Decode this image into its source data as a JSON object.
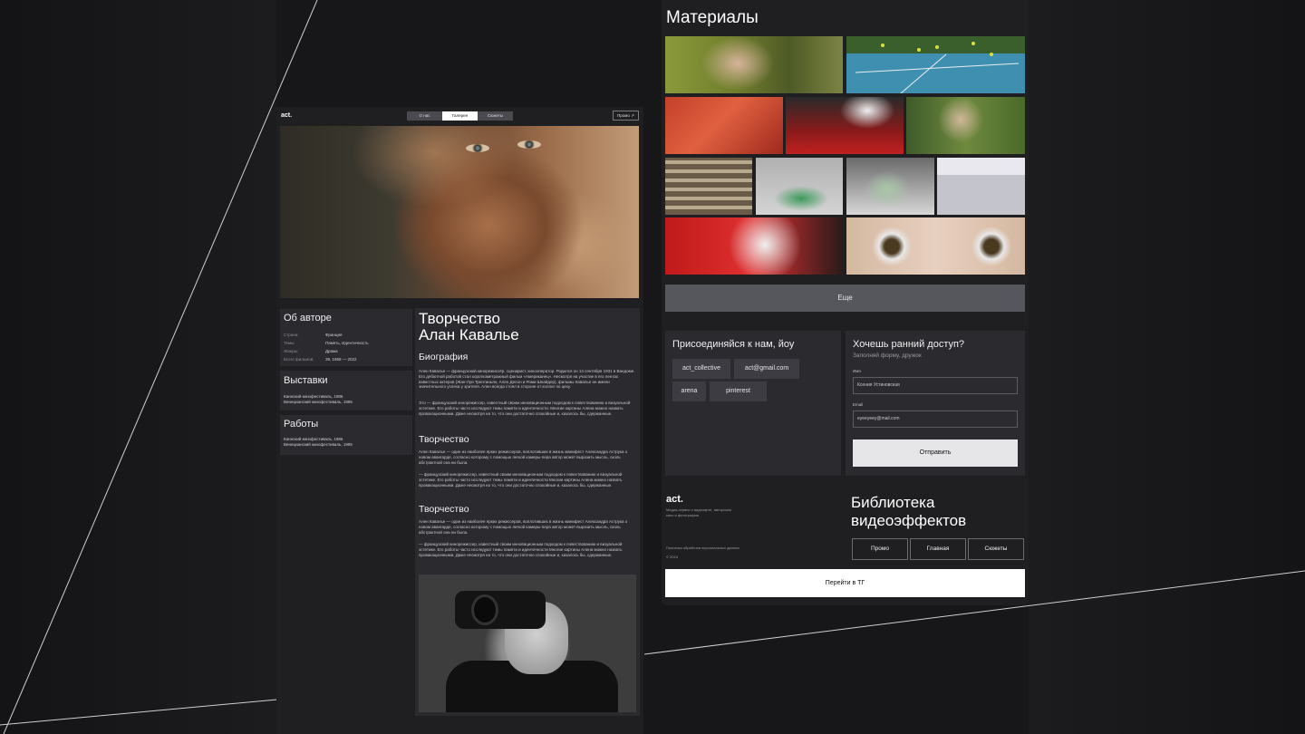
{
  "left": {
    "logo": "act.",
    "tabs": [
      "О нас",
      "Галерея",
      "Сюжеты"
    ],
    "active_tab": "Галерея",
    "promo": "Промо ↗",
    "about": {
      "title": "Об авторе",
      "rows": [
        {
          "label": "Страна:",
          "value": "Франция"
        },
        {
          "label": "Темы:",
          "value": "Память, Идентичность"
        },
        {
          "label": "Жанры:",
          "value": "Драма"
        },
        {
          "label": "Всего фильмов:",
          "value": "39, 1958 — 2022"
        }
      ]
    },
    "exhibitions": {
      "title": "Выставки",
      "lines": [
        "Каннский кинофестиваль, 1986",
        "Венецианский кинофестиваль, 1995"
      ]
    },
    "works": {
      "title": "Работы",
      "lines": [
        "Каннский кинофестиваль, 1986",
        "Венецианский кинофестиваль, 1995"
      ]
    },
    "creation_title_1": "Творчество",
    "creation_title_2": "Алан Кавалье",
    "bio_title": "Биография",
    "bio_p1": "Ален Кавалье — французский кинорежиссёр, сценарист, кинооператор. Родился он 14 сентября 1931 в Вандоме. Его дебютной работой стал короткометражный фильм «Американец». Несмотря на участие в его лентах известных актеров (Жан-Луи Трентиньян, Ален Делон и Роми Шнайдер), фильмы Кавалье не имели значительного успеха у зрителя. Ален всегда стоял в стороне от коллег по цеху.",
    "bio_p2": "Это — французский кинорежиссер, известный своим инновационным подходом к повествованию и визуальной эстетике. Его работы часто исследуют темы памяти и идентичности. Многие картины Алена можно назвать провокационными. Даже несмотря на то, что они достаточно спокойные и, казалось бы, сдержанные.",
    "sec2_title": "Творчество",
    "sec2_p1": "Ален Кавалье — один из наиболее ярких режиссеров, воплотивших в жизнь манифест Александра Аструка о новом авангарде, согласно которому с помощью легкой камеры-пера автор может выразить мысль, сколь абстрактной она ни была.",
    "sec2_p2": "— французский кинорежиссер, известный своим инновационным подходом к повествованию и визуальной эстетике. Его работы часто исследуют темы памяти и идентичности Многие картины Алена можно назвать провакационными. Даже несмотря на то, что они достаточно спокойные и, казалось бы, сдержанные.",
    "sec3_title": "Творчество",
    "sec3_p1": "Ален Кавалье — один из наиболее ярких режиссеров, воплотивших в жизнь манифест Александра Аструка о новом авангарде, согласно которому с помощью легкой камеры-пера автор может выразить мысль, сколь абстрактной она ни была.",
    "sec3_p2": "— французский кинорежиссер, известный своим инновационным подходом к повествованию и визуальной эстетике. Его работы часто исследуют темы памяти и идентичности Многие картины Алена можно назвать провакационными. Даже несмотря на то, что они достаточно спокойные и, казалось бы, сдержанные."
  },
  "right": {
    "materials_title": "Материалы",
    "more_button": "Еще",
    "join": {
      "title": "Присоединяйся к нам, йоу",
      "chips": [
        "act_collective",
        "act@gmail.com",
        "arena",
        "pinterest"
      ]
    },
    "form": {
      "title": "Хочешь ранний доступ?",
      "subtitle": "Заполняй форму, дружок",
      "name_label": "Имя",
      "name_value": "Ксения Устиновская",
      "email_label": "Email",
      "email_value": "eyeeyeey@mail.com",
      "submit": "Отправить"
    },
    "footer": {
      "logo": "act.",
      "desc": "Медиа-сервис о видеоарте, авторском кино и фотографии",
      "policy": "Политика обработки персональных данных",
      "year": "© 2024",
      "library_title": "Библиотека видеоэффектов",
      "nav": [
        "Промо",
        "Главная",
        "Сюжеты"
      ],
      "tg_button": "Перейти в ТГ"
    }
  }
}
